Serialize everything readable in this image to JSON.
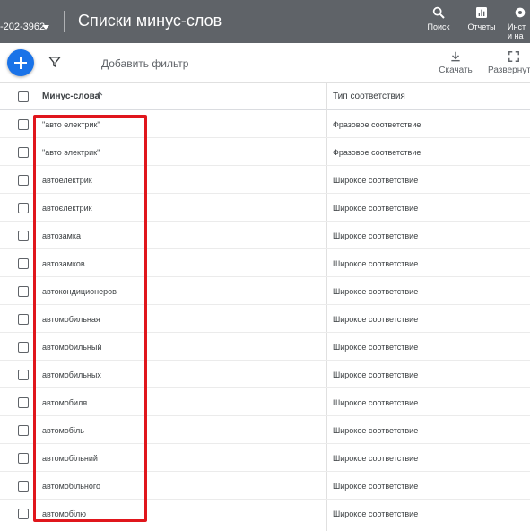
{
  "header": {
    "account_id": "-202-3962",
    "title": "Списки минус-слов",
    "tools": [
      {
        "label": "Поиск",
        "icon": "search-icon"
      },
      {
        "label": "Отчеты",
        "icon": "reports-icon"
      },
      {
        "label": "Инст\nи на",
        "icon": "tools-icon"
      }
    ]
  },
  "toolbar": {
    "add_filter_label": "Добавить фильтр",
    "download_label": "Скачать",
    "expand_label": "Развернуть"
  },
  "table": {
    "columns": [
      "Минус-слова",
      "Тип соответствия"
    ],
    "rows": [
      {
        "keyword": "\"авто електрик\"",
        "match": "Фразовое соответствие"
      },
      {
        "keyword": "\"авто электрик\"",
        "match": "Фразовое соответствие"
      },
      {
        "keyword": "автоелектрик",
        "match": "Широкое соответствие"
      },
      {
        "keyword": "автоєлектрик",
        "match": "Широкое соответствие"
      },
      {
        "keyword": "автозамка",
        "match": "Широкое соответствие"
      },
      {
        "keyword": "автозамков",
        "match": "Широкое соответствие"
      },
      {
        "keyword": "автокондиционеров",
        "match": "Широкое соответствие"
      },
      {
        "keyword": "автомобильная",
        "match": "Широкое соответствие"
      },
      {
        "keyword": "автомобильный",
        "match": "Широкое соответствие"
      },
      {
        "keyword": "автомобильных",
        "match": "Широкое соответствие"
      },
      {
        "keyword": "автомобиля",
        "match": "Широкое соответствие"
      },
      {
        "keyword": "автомобіль",
        "match": "Широкое соответствие"
      },
      {
        "keyword": "автомобільний",
        "match": "Широкое соответствие"
      },
      {
        "keyword": "автомобільного",
        "match": "Широкое соответствие"
      },
      {
        "keyword": "автомобілю",
        "match": "Широкое соответствие"
      }
    ]
  },
  "colors": {
    "appbar": "#5f6368",
    "accent": "#1a73e8",
    "highlight": "#e0161c"
  }
}
